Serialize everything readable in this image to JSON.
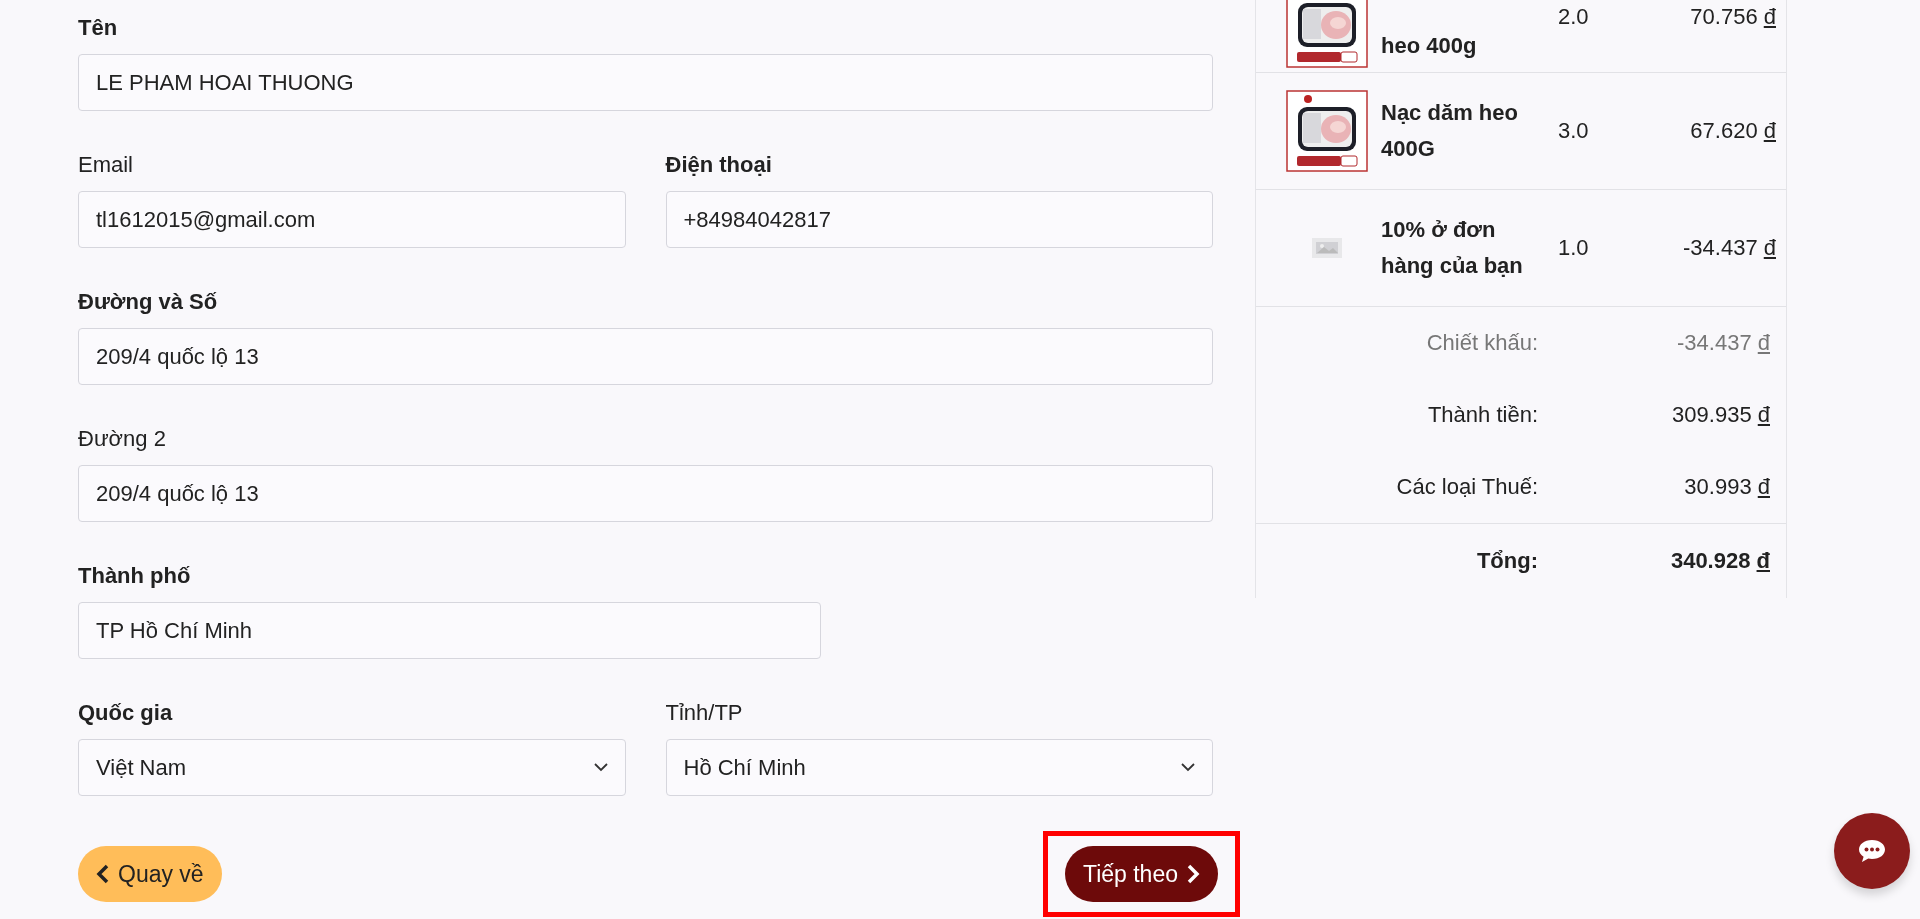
{
  "form": {
    "rows": [
      [
        {
          "label": "Tên",
          "required": true,
          "kind": "input",
          "value": "LE PHAM HOAI THUONG"
        }
      ],
      [
        {
          "label": "Email",
          "required": false,
          "kind": "input",
          "value": "tl1612015@gmail.com"
        },
        {
          "label": "Điện thoại",
          "required": true,
          "kind": "input",
          "value": "+84984042817"
        }
      ],
      [
        {
          "label": "Đường và Số",
          "required": true,
          "kind": "input",
          "value": "209/4 quốc lộ 13"
        }
      ],
      [
        {
          "label": "Đường 2",
          "required": false,
          "kind": "input",
          "value": "209/4 quốc lộ 13"
        }
      ],
      [
        {
          "label": "Thành phố",
          "required": true,
          "kind": "input",
          "value": "TP Hồ Chí Minh"
        }
      ],
      [
        {
          "label": "Quốc gia",
          "required": true,
          "kind": "select",
          "value": "Việt Nam"
        },
        {
          "label": "Tỉnh/TP",
          "required": false,
          "kind": "select",
          "value": "Hồ Chí Minh"
        }
      ]
    ]
  },
  "buttons": [
    {
      "label": "Quay về",
      "kind": "back",
      "highlighted": false
    },
    {
      "label": "Tiếp theo",
      "kind": "next",
      "highlighted": true
    }
  ],
  "cart": {
    "items": [
      {
        "name": "heo 400g",
        "quantity": "2.0",
        "amount": "70.756",
        "currency": "đ",
        "kind": "product"
      },
      {
        "name": "Nạc dăm heo 400G",
        "quantity": "3.0",
        "amount": "67.620",
        "currency": "đ",
        "kind": "product"
      },
      {
        "name": "10% ở đơn hàng của bạn",
        "quantity": "1.0",
        "amount": "-34.437",
        "currency": "đ",
        "kind": "placeholder"
      }
    ],
    "summary": [
      {
        "label": "Chiết khấu:",
        "value": "-34.437",
        "currency": "đ",
        "kind": "muted"
      },
      {
        "label": "Thành tiền:",
        "value": "309.935",
        "currency": "đ",
        "kind": "normal"
      },
      {
        "label": "Các loại Thuế:",
        "value": "30.993",
        "currency": "đ",
        "kind": "normal"
      },
      {
        "label": "Tổng:",
        "value": "340.928",
        "currency": "đ",
        "kind": "total"
      }
    ]
  },
  "chat_button": {
    "kind": "chat"
  }
}
